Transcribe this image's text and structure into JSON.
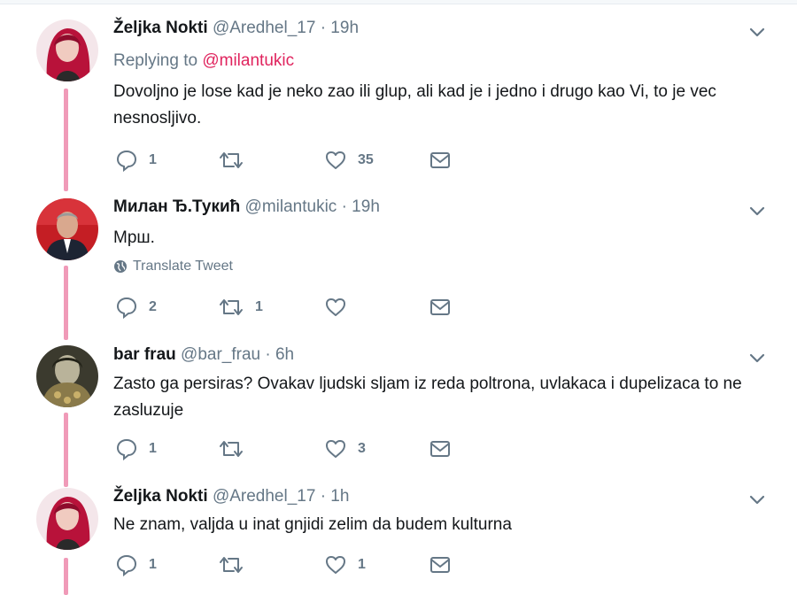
{
  "tweets": [
    {
      "name": "Željka Nokti",
      "handle": "@Aredhel_17",
      "time": "· 19h",
      "replying_label": "Replying to",
      "replying_mention": "@milantukic",
      "text": "Dovoljno je lose kad je neko zao ili glup, ali kad je i jedno i drugo kao Vi, to je vec nesnosljivo.",
      "replies": "1",
      "retweets": "",
      "likes": "35"
    },
    {
      "name": "Милан Ђ.Тукић",
      "handle": "@milantukic",
      "time": "· 19h",
      "text": "Мрш.",
      "translate": "Translate Tweet",
      "replies": "2",
      "retweets": "1",
      "likes": ""
    },
    {
      "name": "bar frau",
      "handle": "@bar_frau",
      "time": "· 6h",
      "text": "Zasto ga persiras? Ovakav ljudski sljam iz reda poltrona, uvlakaca i dupelizaca to ne zasluzuje",
      "replies": "1",
      "retweets": "",
      "likes": "3"
    },
    {
      "name": "Željka Nokti",
      "handle": "@Aredhel_17",
      "time": "· 1h",
      "text": "Ne znam, valjda u inat gnjidi zelim da budem kulturna",
      "replies": "1",
      "retweets": "",
      "likes": "1"
    }
  ],
  "colors": {
    "thread_line": "#f09ab8",
    "mention": "#e0245e",
    "secondary_text": "#657786",
    "icon": "#657786"
  },
  "icons": [
    "chevron-down-icon",
    "reply-icon",
    "retweet-icon",
    "like-icon",
    "message-icon",
    "globe-icon"
  ]
}
